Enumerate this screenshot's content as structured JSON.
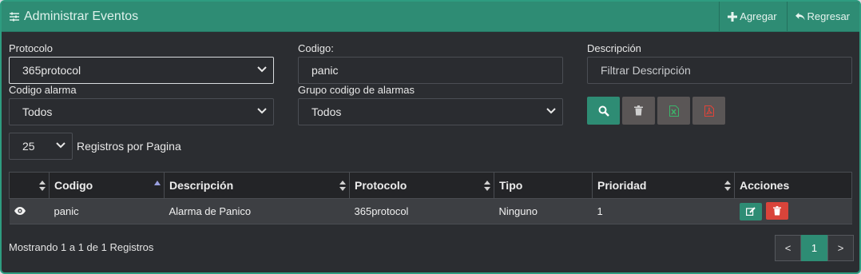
{
  "header": {
    "title": "Administrar Eventos",
    "add_label": "Agregar",
    "back_label": "Regresar"
  },
  "filters": {
    "protocolo": {
      "label": "Protocolo",
      "value": "365protocol"
    },
    "codigo": {
      "label": "Codigo:",
      "value": "panic"
    },
    "descripcion": {
      "label": "Descripción",
      "placeholder": "Filtrar Descripción"
    },
    "codigo_alarma": {
      "label": "Codigo alarma",
      "value": "Todos"
    },
    "grupo": {
      "label": "Grupo codigo de alarmas",
      "value": "Todos"
    }
  },
  "buttons": {
    "colors": {
      "search": "#2e8c74",
      "clear": "#5a5656",
      "excel": "#5a5656",
      "pdf": "#5a5656"
    },
    "icons": [
      "search-icon",
      "trash-icon",
      "excel-icon",
      "pdf-icon"
    ]
  },
  "pagination_size": {
    "value": "25",
    "label": "Registros por Pagina"
  },
  "table": {
    "columns": [
      "",
      "Codigo",
      "Descripción",
      "Protocolo",
      "Tipo",
      "Prioridad",
      "Acciones"
    ],
    "rows": [
      {
        "codigo": "panic",
        "descripcion": "Alarma de Panico",
        "protocolo": "365protocol",
        "tipo": "Ninguno",
        "prioridad": "1"
      }
    ]
  },
  "footer": {
    "info": "Mostrando 1 a 1 de 1 Registros",
    "prev": "<",
    "page": "1",
    "next": ">"
  },
  "colors": {
    "accent": "#2e8c74",
    "danger": "#d9443a",
    "panel": "#2b2d31"
  }
}
